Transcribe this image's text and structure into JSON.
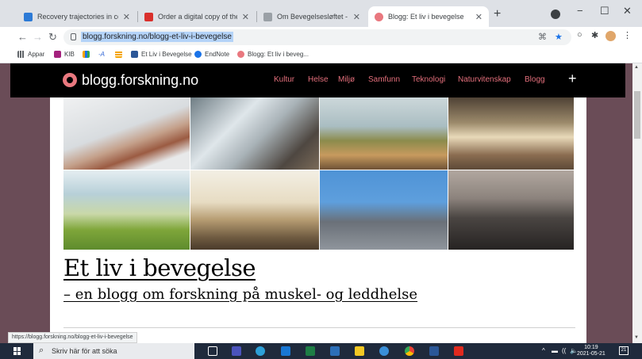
{
  "browser": {
    "tabs": [
      {
        "title": "Recovery trajectories in commor",
        "fav_color": "#2c7ad6",
        "active": false
      },
      {
        "title": "Order a digital copy of the thesis",
        "fav_color": "#d9302c",
        "active": false
      },
      {
        "title": "Om Bevegelsesløftet - Bevegelse",
        "fav_color": "#9aa0a6",
        "active": false
      },
      {
        "title": "Blogg: Et liv i bevegelse",
        "fav_color": "#e9787f",
        "active": true
      }
    ],
    "new_tab": "+",
    "window_controls": {
      "minimize": "−",
      "maximize": "☐",
      "close": "✕"
    },
    "url": "blogg.forskning.no/blogg-et-liv-i-bevegelse",
    "icons": {
      "back": "←",
      "forward": "→",
      "reload": "↻",
      "translate": "⌘",
      "star": "★",
      "menu": "⋮",
      "more_ext": "⁂",
      "puzzle": "✱"
    }
  },
  "bookmarks": [
    {
      "label": "Appar",
      "icon": "apps-icon",
      "color": "#5f6368"
    },
    {
      "label": "KIB",
      "icon": "kib-icon",
      "color": "#a4217d"
    },
    {
      "label": "",
      "icon": "bars-icon",
      "color": "#1a73e8"
    },
    {
      "label": "",
      "icon": "a-icon",
      "color": "#3367d6"
    },
    {
      "label": "",
      "icon": "grid-icon",
      "color": "#f4a300"
    },
    {
      "label": "Et Liv i Bevegelse",
      "icon": "w-icon",
      "color": "#2b5797"
    },
    {
      "label": "EndNote",
      "icon": "endnote-icon",
      "color": "#1a73e8"
    },
    {
      "label": "Blogg: Et liv i beveg...",
      "icon": "blogg-icon",
      "color": "#e9787f"
    }
  ],
  "site": {
    "logo": "blogg.forskning.no",
    "nav": [
      "Kultur",
      "Helse",
      "Miljø",
      "Samfunn",
      "Teknologi",
      "Naturvitenskap",
      "Blogg"
    ],
    "plus": "+",
    "title": "Et liv i bevegelse",
    "subtitle": "– en blogg om forskning på muskel- og leddhelse",
    "accent": "#e36f7b",
    "background": "#6a4c57"
  },
  "photos": [
    {
      "name": "photo-stretching",
      "colors": [
        "#e9ecef",
        "#c9b6a6",
        "#8c6a55"
      ]
    },
    {
      "name": "photo-hiking-boots",
      "colors": [
        "#6e7a80",
        "#c8d0d4",
        "#4b4540"
      ]
    },
    {
      "name": "photo-hikers-helping",
      "colors": [
        "#b7c6c9",
        "#7a8a3a",
        "#c49a68"
      ]
    },
    {
      "name": "photo-runners",
      "colors": [
        "#6d5a46",
        "#d8c6a8",
        "#8a6c50"
      ]
    },
    {
      "name": "photo-seniors-exercise",
      "colors": [
        "#cfe0e6",
        "#83a83c",
        "#e0d9c8"
      ]
    },
    {
      "name": "photo-family-walking",
      "colors": [
        "#e8dfcc",
        "#b9a27a",
        "#5c4a36"
      ]
    },
    {
      "name": "photo-kids-rollerskating",
      "colors": [
        "#5b9ad8",
        "#3e74b7",
        "#6a7078"
      ]
    },
    {
      "name": "photo-barbell",
      "colors": [
        "#9a918a",
        "#5a5552",
        "#2b2826"
      ]
    }
  ],
  "status_url": "https://blogg.forskning.no/blogg-et-liv-i-bevegelse",
  "taskbar": {
    "search_placeholder": "Skriv här för att söka",
    "time": "10:19",
    "date": "2021-05-21",
    "notifications": "21",
    "apps": [
      {
        "name": "taskview-icon",
        "color": "#ffffff"
      },
      {
        "name": "teams-icon",
        "color": "#4b53bc"
      },
      {
        "name": "edge-icon",
        "color": "#2da0d8"
      },
      {
        "name": "outlook-icon",
        "color": "#1877d4"
      },
      {
        "name": "excel-icon",
        "color": "#1e7e45"
      },
      {
        "name": "explorer-icon",
        "color": "#2c6fb8"
      },
      {
        "name": "sticky-icon",
        "color": "#f3c824"
      },
      {
        "name": "globe-icon",
        "color": "#3a8fd8"
      },
      {
        "name": "chrome-icon",
        "color": "#f1b328"
      },
      {
        "name": "word-icon",
        "color": "#2b5797"
      },
      {
        "name": "acrobat-icon",
        "color": "#e02a1e"
      }
    ],
    "tray_icons": [
      "^",
      "▬",
      "((",
      "🔈"
    ]
  }
}
